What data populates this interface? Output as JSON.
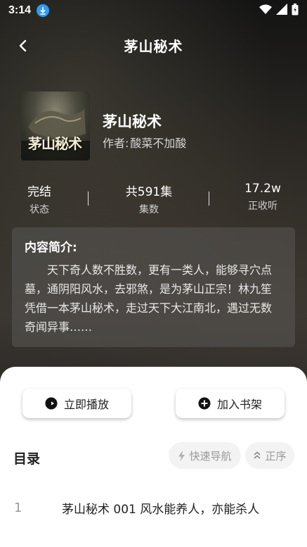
{
  "status_bar": {
    "time": "3:14"
  },
  "header": {
    "title": "茅山秘术"
  },
  "book": {
    "cover_text": "茅山秘术",
    "title": "茅山秘术",
    "author_label": "作者:",
    "author": "酸菜不加酸"
  },
  "stats": [
    {
      "value": "完结",
      "label": "状态"
    },
    {
      "value": "共591集",
      "label": "集数"
    },
    {
      "value": "17.2w",
      "label": "正收听"
    }
  ],
  "intro": {
    "title": "内容简介:",
    "text": "天下奇人数不胜数，更有一类人，能够寻穴点墓，通阴阳风水，去邪煞，是为茅山正宗！林九笙凭借一本茅山秘术，走过天下大江南北，遇过无数奇闻异事……"
  },
  "actions": {
    "play": "立即播放",
    "add_shelf": "加入书架"
  },
  "toc": {
    "title": "目录",
    "quick_nav": "快速导航",
    "order": "正序",
    "chapters": [
      {
        "num": "1",
        "title": "茅山秘术 001 风水能养人，亦能杀人"
      }
    ]
  },
  "colors": {
    "accent_download": "#2f9cf4",
    "sheet_bg": "#ffffff",
    "chip_bg": "#f3f3f3"
  }
}
